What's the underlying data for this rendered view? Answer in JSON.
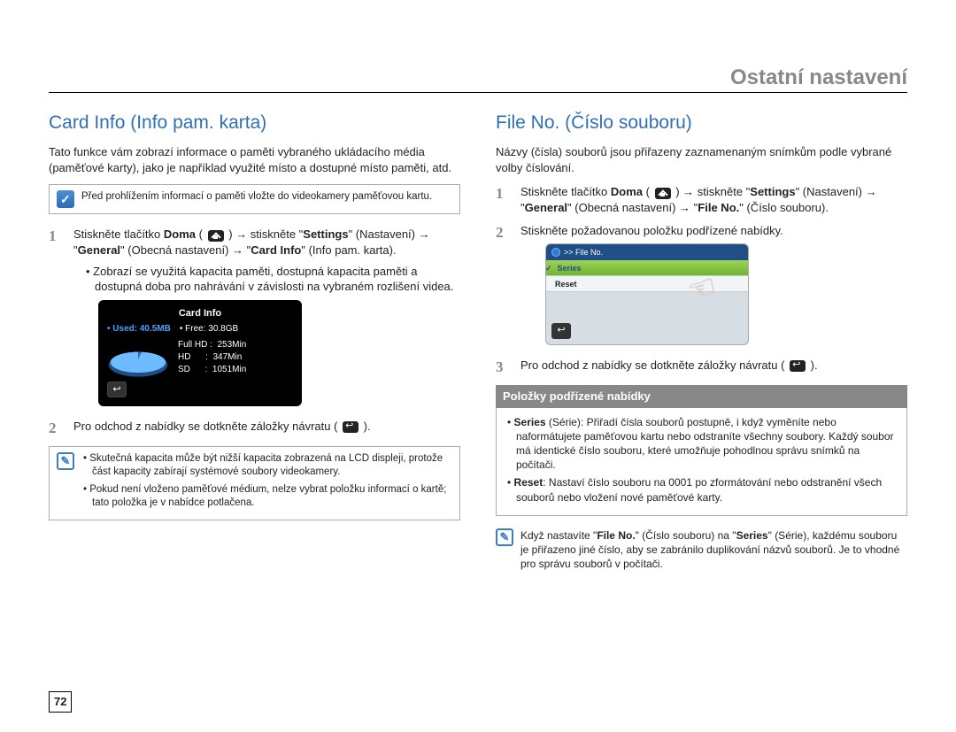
{
  "header": {
    "title": "Ostatní nastavení"
  },
  "page_number": "72",
  "icons": {
    "home": "home-icon",
    "back": "return-icon"
  },
  "left": {
    "heading": "Card Info (Info pam. karta)",
    "intro": "Tato funkce vám zobrazí informace o paměti vybraného ukládacího média (paměťové karty), jako je například využité místo a dostupné místo paměti, atd.",
    "pre_note": "Před prohlížením informací o paměti vložte do videokamery paměťovou kartu.",
    "steps": {
      "s1_a": "Stiskněte tlačítko ",
      "s1_b": "Doma",
      "s1_c": " ( ",
      "s1_d": " ) → stiskněte \"",
      "s1_e": "Settings",
      "s1_f": "\" (Nastavení) → \"",
      "s1_g": "General",
      "s1_h": "\" (Obecná nastavení) → \"",
      "s1_i": "Card Info",
      "s1_j": "\" (Info pam. karta).",
      "s1_bullet": "Zobrazí se využitá kapacita paměti, dostupná kapacita paměti a dostupná doba pro nahrávání v závislosti na vybraném rozlišení videa.",
      "s2_a": "Pro odchod z nabídky se dotkněte záložky návratu ( ",
      "s2_b": " )."
    },
    "cardinfo_screen": {
      "title": "Card Info",
      "used_label": "• Used: 40.5MB",
      "free_label": "• Free: 30.8GB",
      "rows": [
        {
          "label": "Full HD",
          "sep": ":",
          "value": "253Min"
        },
        {
          "label": "HD",
          "sep": ":",
          "value": "347Min"
        },
        {
          "label": "SD",
          "sep": ":",
          "value": "1051Min"
        }
      ]
    },
    "post_note": {
      "li1": "Skutečná kapacita může být nižší kapacita zobrazená na LCD displeji, protože část kapacity zabírají systémové soubory videokamery.",
      "li2": "Pokud není vloženo paměťové médium, nelze vybrat položku informací o kartě; tato položka je v nabídce potlačena."
    }
  },
  "right": {
    "heading": "File No. (Číslo souboru)",
    "intro": "Názvy (čísla) souborů jsou přiřazeny zaznamenaným snímkům podle vybrané volby číslování.",
    "steps": {
      "s1_a": "Stiskněte tlačítko ",
      "s1_b": "Doma",
      "s1_c": " ( ",
      "s1_d": " ) → stiskněte \"",
      "s1_e": "Settings",
      "s1_f": "\" (Nastavení) → \"",
      "s1_g": "General",
      "s1_h": "\" (Obecná nastavení) → \"",
      "s1_i": "File No.",
      "s1_j": "\" (Číslo souboru).",
      "s2": "Stiskněte požadovanou položku podřízené nabídky.",
      "s3_a": "Pro odchod z nabídky se dotkněte záložky návratu ( ",
      "s3_b": " )."
    },
    "fileno_screen": {
      "breadcrumb": ">> File No.",
      "item_series": "Series",
      "item_reset": "Reset"
    },
    "submenu": {
      "header": "Položky podřízené nabídky",
      "series_label": "Series",
      "series_text": " (Série): Přiřadí čísla souborů postupně, i když vyměníte nebo naformátujete paměťovou kartu nebo odstraníte všechny soubory. Každý soubor má identické číslo souboru, které umožňuje pohodlnou správu snímků na počítači.",
      "reset_label": "Reset",
      "reset_text": ": Nastaví číslo souboru na 0001 po zformátování nebo odstranění všech souborů nebo vložení nové paměťové karty."
    },
    "tip": {
      "a": "Když nastavíte \"",
      "b": "File No.",
      "c": "\" (Číslo souboru) na \"",
      "d": "Series",
      "e": "\" (Série), každému souboru je přiřazeno jiné číslo, aby se zabránilo duplikování názvů souborů. Je to vhodné pro správu souborů v počítači."
    }
  }
}
